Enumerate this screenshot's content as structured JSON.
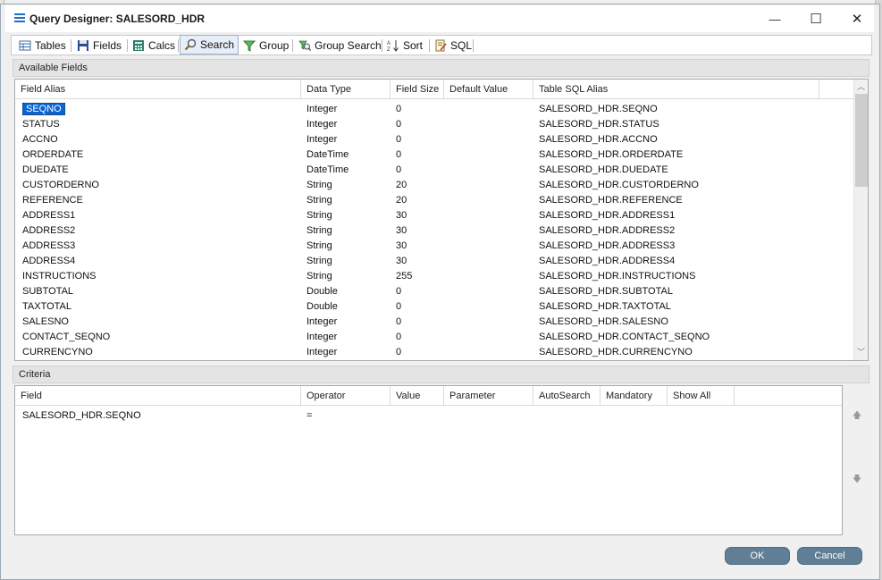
{
  "window": {
    "title": "Query Designer: SALESORD_HDR",
    "controls": {
      "minimize": "—",
      "maximize": "☐",
      "close": "✕"
    }
  },
  "tabs": [
    {
      "label": "Tables",
      "icon": "table-icon"
    },
    {
      "label": "Fields",
      "icon": "save-disk-icon"
    },
    {
      "label": "Calcs",
      "icon": "calculator-icon"
    },
    {
      "label": "Search",
      "icon": "magnifier-icon",
      "active": true
    },
    {
      "label": "Group",
      "icon": "filter-funnel-icon"
    },
    {
      "label": "Group Search",
      "icon": "group-search-icon"
    },
    {
      "label": "Sort",
      "icon": "sort-az-icon"
    },
    {
      "label": "SQL",
      "icon": "sql-script-icon"
    }
  ],
  "available_fields": {
    "title": "Available Fields",
    "columns": [
      "Field Alias",
      "Data Type",
      "Field Size",
      "Default Value",
      "Table SQL Alias"
    ],
    "rows": [
      {
        "alias": "SEQNO",
        "type": "Integer",
        "size": "0",
        "default": "",
        "sql": "SALESORD_HDR.SEQNO",
        "selected": true
      },
      {
        "alias": "STATUS",
        "type": "Integer",
        "size": "0",
        "default": "",
        "sql": "SALESORD_HDR.STATUS"
      },
      {
        "alias": "ACCNO",
        "type": "Integer",
        "size": "0",
        "default": "",
        "sql": "SALESORD_HDR.ACCNO"
      },
      {
        "alias": "ORDERDATE",
        "type": "DateTime",
        "size": "0",
        "default": "",
        "sql": "SALESORD_HDR.ORDERDATE"
      },
      {
        "alias": "DUEDATE",
        "type": "DateTime",
        "size": "0",
        "default": "",
        "sql": "SALESORD_HDR.DUEDATE"
      },
      {
        "alias": "CUSTORDERNO",
        "type": "String",
        "size": "20",
        "default": "",
        "sql": "SALESORD_HDR.CUSTORDERNO"
      },
      {
        "alias": "REFERENCE",
        "type": "String",
        "size": "20",
        "default": "",
        "sql": "SALESORD_HDR.REFERENCE"
      },
      {
        "alias": "ADDRESS1",
        "type": "String",
        "size": "30",
        "default": "",
        "sql": "SALESORD_HDR.ADDRESS1"
      },
      {
        "alias": "ADDRESS2",
        "type": "String",
        "size": "30",
        "default": "",
        "sql": "SALESORD_HDR.ADDRESS2"
      },
      {
        "alias": "ADDRESS3",
        "type": "String",
        "size": "30",
        "default": "",
        "sql": "SALESORD_HDR.ADDRESS3"
      },
      {
        "alias": "ADDRESS4",
        "type": "String",
        "size": "30",
        "default": "",
        "sql": "SALESORD_HDR.ADDRESS4"
      },
      {
        "alias": "INSTRUCTIONS",
        "type": "String",
        "size": "255",
        "default": "",
        "sql": "SALESORD_HDR.INSTRUCTIONS"
      },
      {
        "alias": "SUBTOTAL",
        "type": "Double",
        "size": "0",
        "default": "",
        "sql": "SALESORD_HDR.SUBTOTAL"
      },
      {
        "alias": "TAXTOTAL",
        "type": "Double",
        "size": "0",
        "default": "",
        "sql": "SALESORD_HDR.TAXTOTAL"
      },
      {
        "alias": "SALESNO",
        "type": "Integer",
        "size": "0",
        "default": "",
        "sql": "SALESORD_HDR.SALESNO"
      },
      {
        "alias": "CONTACT_SEQNO",
        "type": "Integer",
        "size": "0",
        "default": "",
        "sql": "SALESORD_HDR.CONTACT_SEQNO"
      },
      {
        "alias": "CURRENCYNO",
        "type": "Integer",
        "size": "0",
        "default": "",
        "sql": "SALESORD_HDR.CURRENCYNO"
      }
    ]
  },
  "criteria": {
    "title": "Criteria",
    "columns": [
      "Field",
      "Operator",
      "Value",
      "Parameter",
      "AutoSearch",
      "Mandatory",
      "Show All"
    ],
    "rows": [
      {
        "field": "SALESORD_HDR.SEQNO",
        "operator": "=",
        "value": "",
        "parameter": "",
        "autosearch": "",
        "mandatory": "",
        "showall": ""
      }
    ],
    "move_up": "🡅",
    "move_down": "🡇"
  },
  "buttons": {
    "ok": "OK",
    "cancel": "Cancel"
  },
  "colors": {
    "selection": "#0a64d2",
    "button": "#607f97",
    "title_icon": "#1e6fc4"
  }
}
